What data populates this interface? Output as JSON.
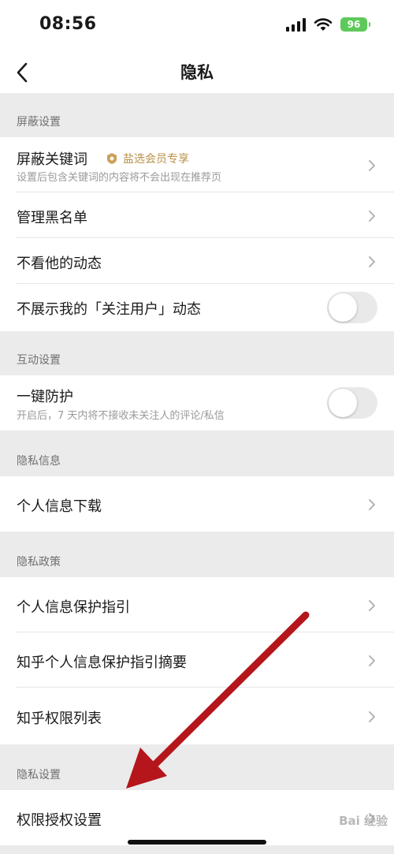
{
  "status_bar": {
    "time": "08:56",
    "battery": "96"
  },
  "nav": {
    "title": "隐私"
  },
  "sections": [
    {
      "header": "屏蔽设置"
    },
    {
      "header": "互动设置"
    },
    {
      "header": "隐私信息"
    },
    {
      "header": "隐私政策"
    },
    {
      "header": "隐私设置"
    }
  ],
  "rows": {
    "block_keywords": {
      "title": "屏蔽关键词",
      "badge": "盐选会员专享",
      "subtitle": "设置后包含关键词的内容将不会出现在推荐页"
    },
    "blacklist": {
      "title": "管理黑名单"
    },
    "hide_their_activity": {
      "title": "不看他的动态"
    },
    "hide_my_follow_activity": {
      "title": "不展示我的「关注用户」动态",
      "toggle_on": false
    },
    "one_click_protect": {
      "title": "一键防护",
      "subtitle": "开启后，7 天内将不接收未关注人的评论/私信",
      "toggle_on": false
    },
    "personal_info_download": {
      "title": "个人信息下载"
    },
    "info_protection_guide": {
      "title": "个人信息保护指引"
    },
    "info_protection_summary": {
      "title": "知乎个人信息保护指引摘要"
    },
    "permission_list": {
      "title": "知乎权限列表"
    },
    "permission_settings": {
      "title": "权限授权设置"
    }
  },
  "watermark": "Bai 经验",
  "colors": {
    "annotation_arrow": "#b5161b",
    "vip_gold": "#b8924a",
    "battery_green": "#5ec95a"
  }
}
